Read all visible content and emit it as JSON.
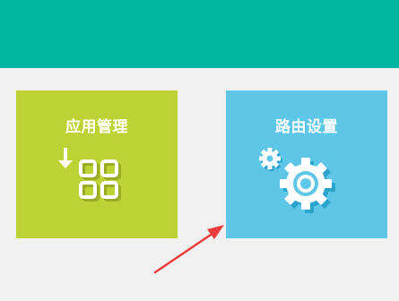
{
  "colors": {
    "header": "#00b5a0",
    "background": "#f1f1f1",
    "tile_app": "#bdd335",
    "tile_route": "#5ec6e6",
    "arrow": "#ee3b3b"
  },
  "tiles": [
    {
      "title": "应用管理",
      "icon": "app-grid-download-icon"
    },
    {
      "title": "路由设置",
      "icon": "gears-icon"
    }
  ],
  "annotation": {
    "icon": "red-arrow-icon"
  }
}
